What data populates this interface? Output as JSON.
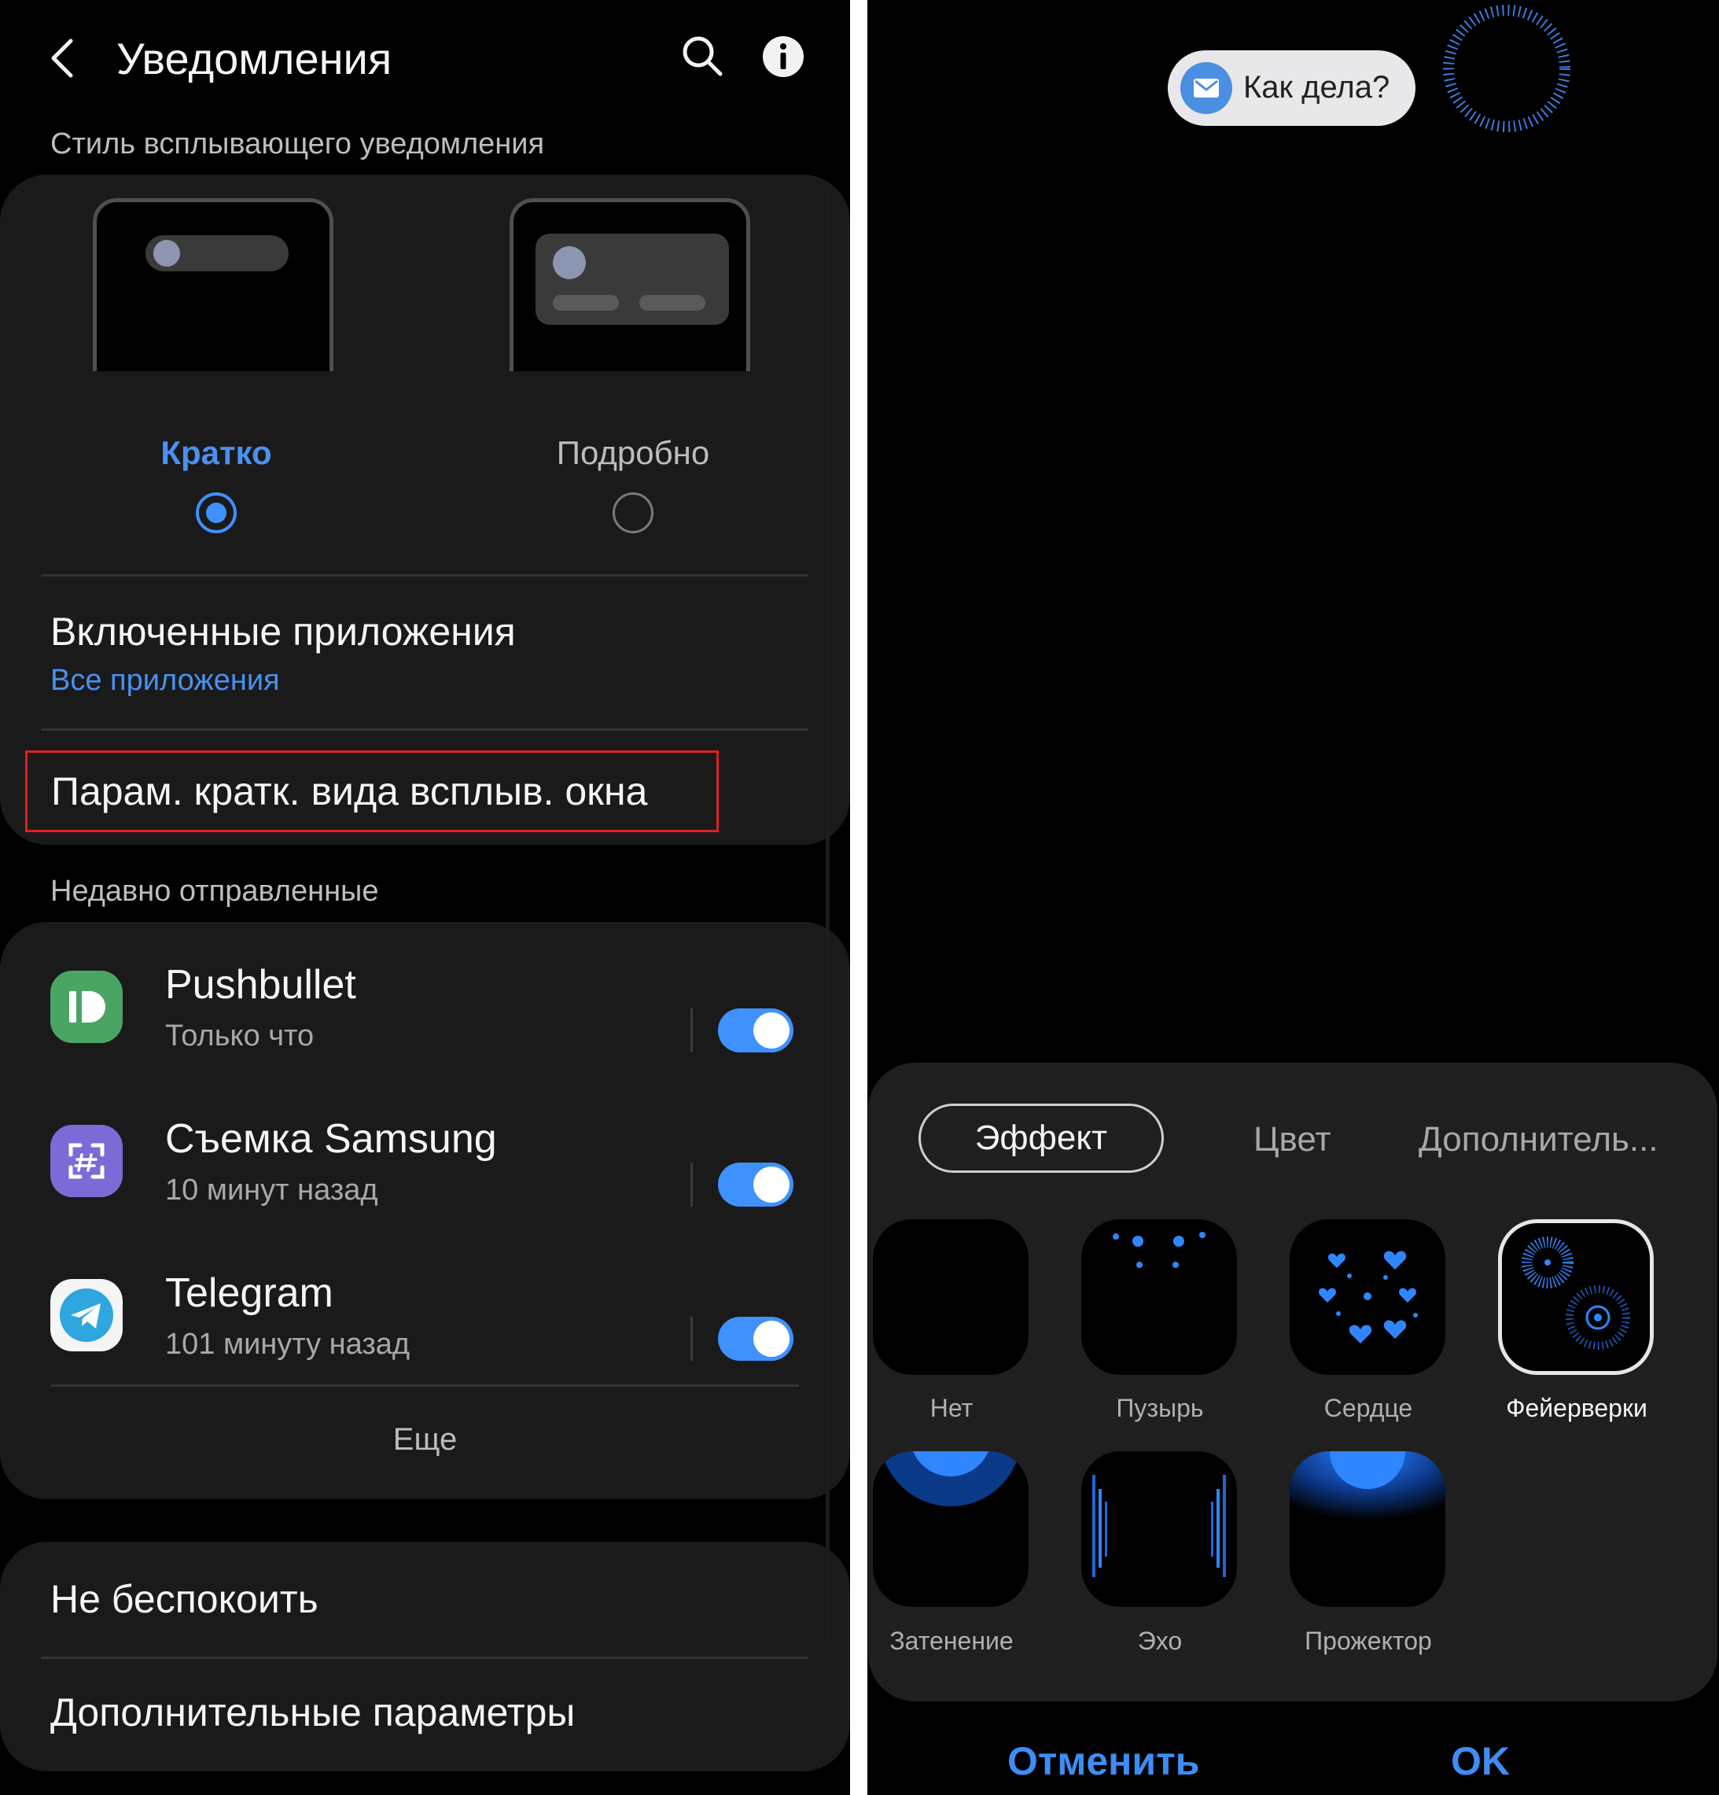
{
  "left": {
    "header": {
      "title": "Уведомления",
      "back_icon": "chevron-left-icon",
      "search_icon": "search-icon",
      "info_icon": "info-icon"
    },
    "popup_style": {
      "section_label": "Стиль всплывающего уведомления",
      "option_brief": "Кратко",
      "option_detailed": "Подробно",
      "selected": "Кратко"
    },
    "enabled_apps": {
      "title": "Включенные приложения",
      "value": "Все приложения"
    },
    "brief_settings": {
      "title": "Парам. кратк. вида всплыв. окна"
    },
    "recent": {
      "section_label": "Недавно отправленные",
      "apps": [
        {
          "name": "Pushbullet",
          "time": "Только что",
          "enabled": true
        },
        {
          "name": "Съемка Samsung",
          "time": "10 минут назад",
          "enabled": true
        },
        {
          "name": "Telegram",
          "time": "101 минуту назад",
          "enabled": true
        }
      ],
      "more_label": "Еще"
    },
    "dnd": {
      "title": "Не беспокоить"
    },
    "advanced": {
      "title": "Дополнительные параметры"
    }
  },
  "right": {
    "preview": {
      "text": "Как дела?",
      "icon": "mail-icon"
    },
    "tabs": {
      "effect": "Эффект",
      "color": "Цвет",
      "more": "Дополнитель..."
    },
    "effects": [
      {
        "label": "Нет"
      },
      {
        "label": "Пузырь"
      },
      {
        "label": "Сердце"
      },
      {
        "label": "Фейерверки"
      },
      {
        "label": "Затенение"
      },
      {
        "label": "Эхо"
      },
      {
        "label": "Прожектор"
      }
    ],
    "selected_effect": "Фейерверки",
    "buttons": {
      "cancel": "Отменить",
      "ok": "OK"
    }
  },
  "colors": {
    "accent": "#3e91ff",
    "highlight_box": "#e02020"
  }
}
